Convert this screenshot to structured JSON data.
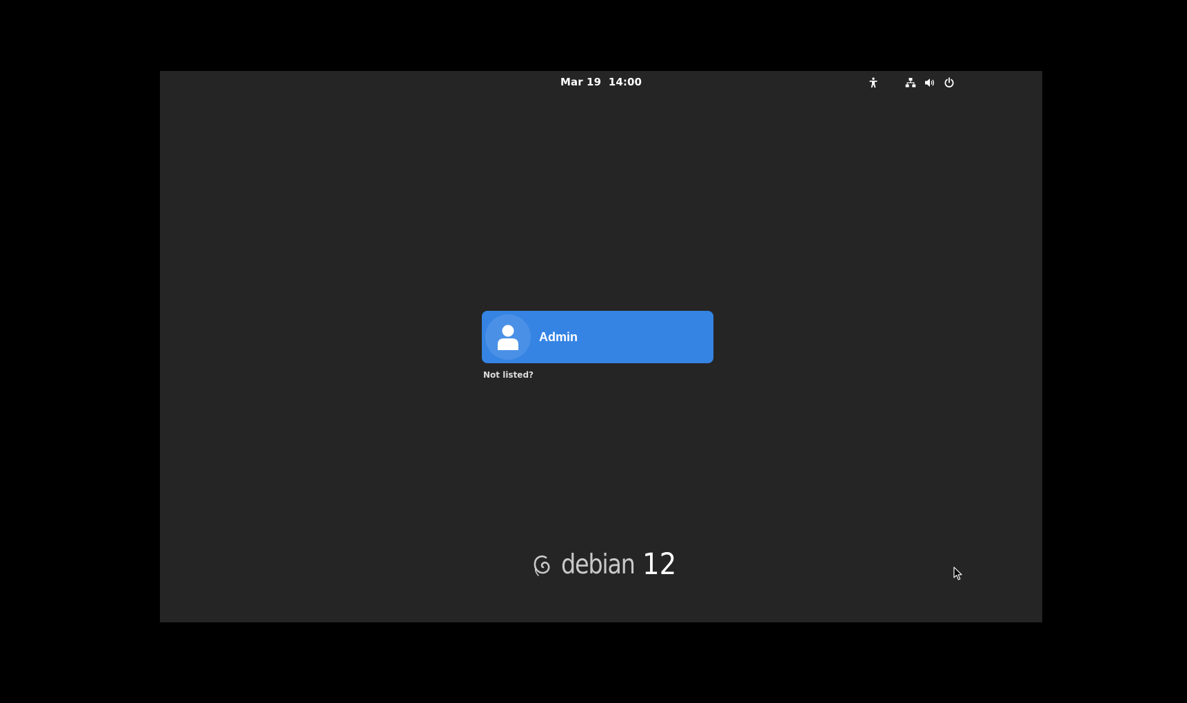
{
  "top_bar": {
    "date": "Mar 19",
    "time": "14:00",
    "icons": [
      "accessibility-icon",
      "network-icon",
      "volume-icon",
      "power-icon"
    ]
  },
  "login": {
    "users": [
      {
        "name": "Admin",
        "icon": "user-avatar-icon"
      }
    ],
    "not_listed_label": "Not listed?"
  },
  "branding": {
    "logo_icon": "debian-swirl-icon",
    "word": "debian",
    "version": "12"
  },
  "colors": {
    "background": "#000000",
    "screen": "#252525",
    "accent": "#3584e4",
    "text": "#ffffff"
  }
}
